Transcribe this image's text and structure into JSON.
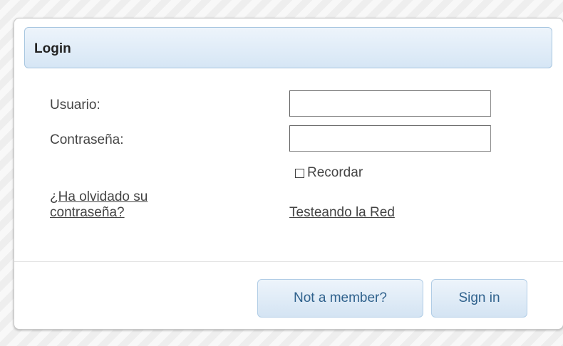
{
  "login": {
    "title": "Login",
    "username_label": "Usuario:",
    "username_value": "",
    "password_label": "Contraseña:",
    "password_value": "",
    "remember_label": "Recordar",
    "remember_checked": false,
    "forgot_password_link": "¿Ha olvidado su contraseña?",
    "network_test_link": "Testeando la Red",
    "not_member_button": "Not a member?",
    "sign_in_button": "Sign in"
  },
  "colors": {
    "header_bg": "#dbe9f6",
    "button_text": "#30628d",
    "text": "#444444"
  }
}
